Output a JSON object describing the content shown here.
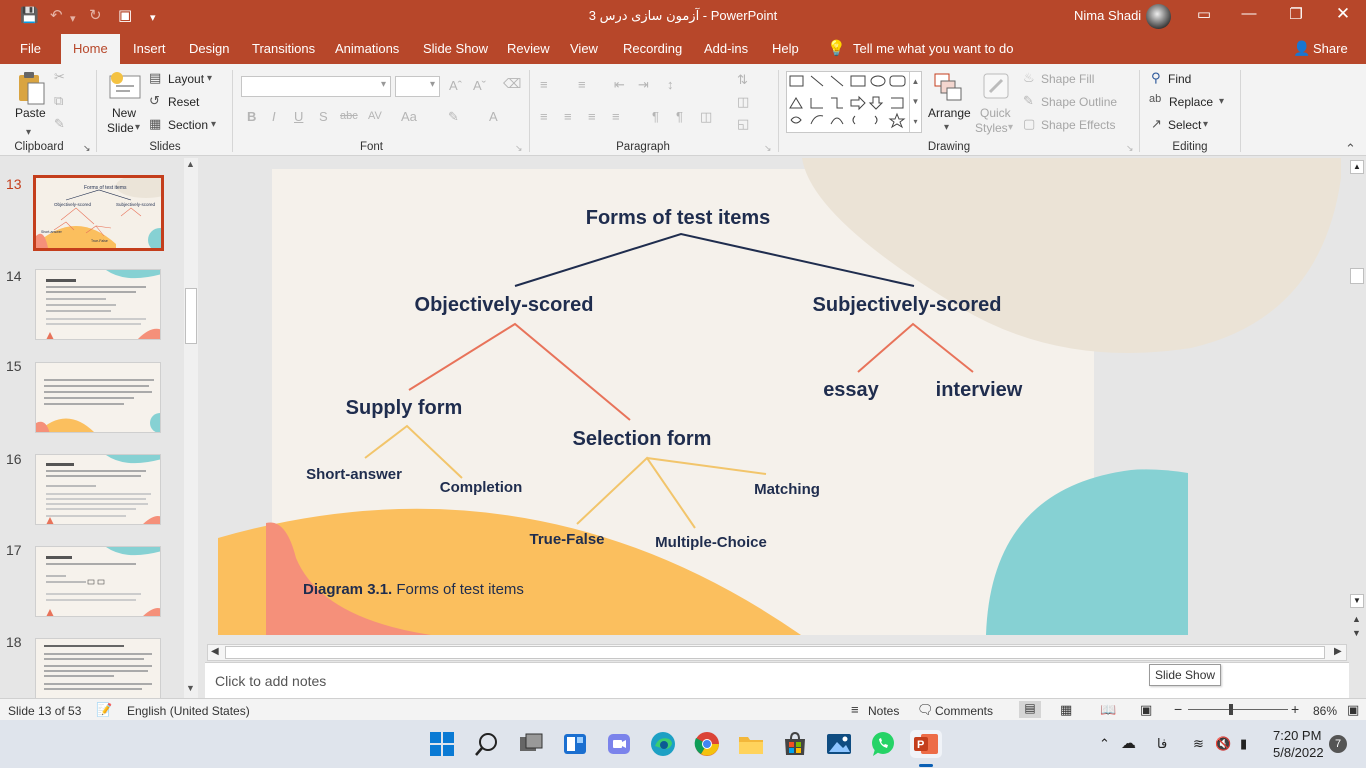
{
  "title_bar": {
    "document_title": "آزمون سازی درس 3",
    "separator": " - ",
    "app_name": "PowerPoint",
    "user_name": "Nima Shadi"
  },
  "ribbon_tabs": [
    "File",
    "Home",
    "Insert",
    "Design",
    "Transitions",
    "Animations",
    "Slide Show",
    "Review",
    "View",
    "Recording",
    "Add-ins",
    "Help"
  ],
  "tell_me": "Tell me what you want to do",
  "share_label": "Share",
  "groups": {
    "clipboard": {
      "label": "Clipboard",
      "paste": "Paste"
    },
    "slides": {
      "label": "Slides",
      "new_slide_1": "New",
      "new_slide_2": "Slide",
      "layout": "Layout",
      "reset": "Reset",
      "section": "Section"
    },
    "font": {
      "label": "Font"
    },
    "paragraph": {
      "label": "Paragraph"
    },
    "drawing": {
      "label": "Drawing",
      "arrange": "Arrange",
      "quick_styles_1": "Quick",
      "quick_styles_2": "Styles",
      "shape_fill": "Shape Fill",
      "shape_outline": "Shape Outline",
      "shape_effects": "Shape Effects"
    },
    "editing": {
      "label": "Editing",
      "find": "Find",
      "replace": "Replace",
      "select": "Select"
    }
  },
  "thumbnails": [
    {
      "number": "13"
    },
    {
      "number": "14"
    },
    {
      "number": "15"
    },
    {
      "number": "16"
    },
    {
      "number": "17"
    },
    {
      "number": "18"
    }
  ],
  "slide": {
    "title": "Forms of test  items",
    "objective": "Objectively-scored",
    "subjective": "Subjectively-scored",
    "supply": "Supply form",
    "selection": "Selection form",
    "essay": "essay",
    "interview": "interview",
    "short_answer": "Short-answer",
    "completion": "Completion",
    "matching": "Matching",
    "true_false": "True-False",
    "multiple_choice": "Multiple-Choice",
    "caption_bold": "Diagram 3.1.",
    "caption_rest": " Forms of test items"
  },
  "notes_placeholder": "Click to add notes",
  "status": {
    "slide_info": "Slide 13 of 53",
    "language": "English (United States)",
    "notes": "Notes",
    "comments": "Comments",
    "zoom": "86%",
    "zoom_fraction": 0.86
  },
  "tooltip": "Slide Show",
  "taskbar": {
    "lang": "فا",
    "time": "7:20 PM",
    "date": "5/8/2022",
    "badge": "7"
  },
  "colors": {
    "accent": "#b7472a",
    "diagram_text": "#1f2d4e",
    "line_orange": "#e8735a",
    "line_yellow": "#f2c56b",
    "blob_teal": "#86d1d3",
    "blob_orange": "#fbbf5e",
    "blob_coral": "#f5907a"
  }
}
